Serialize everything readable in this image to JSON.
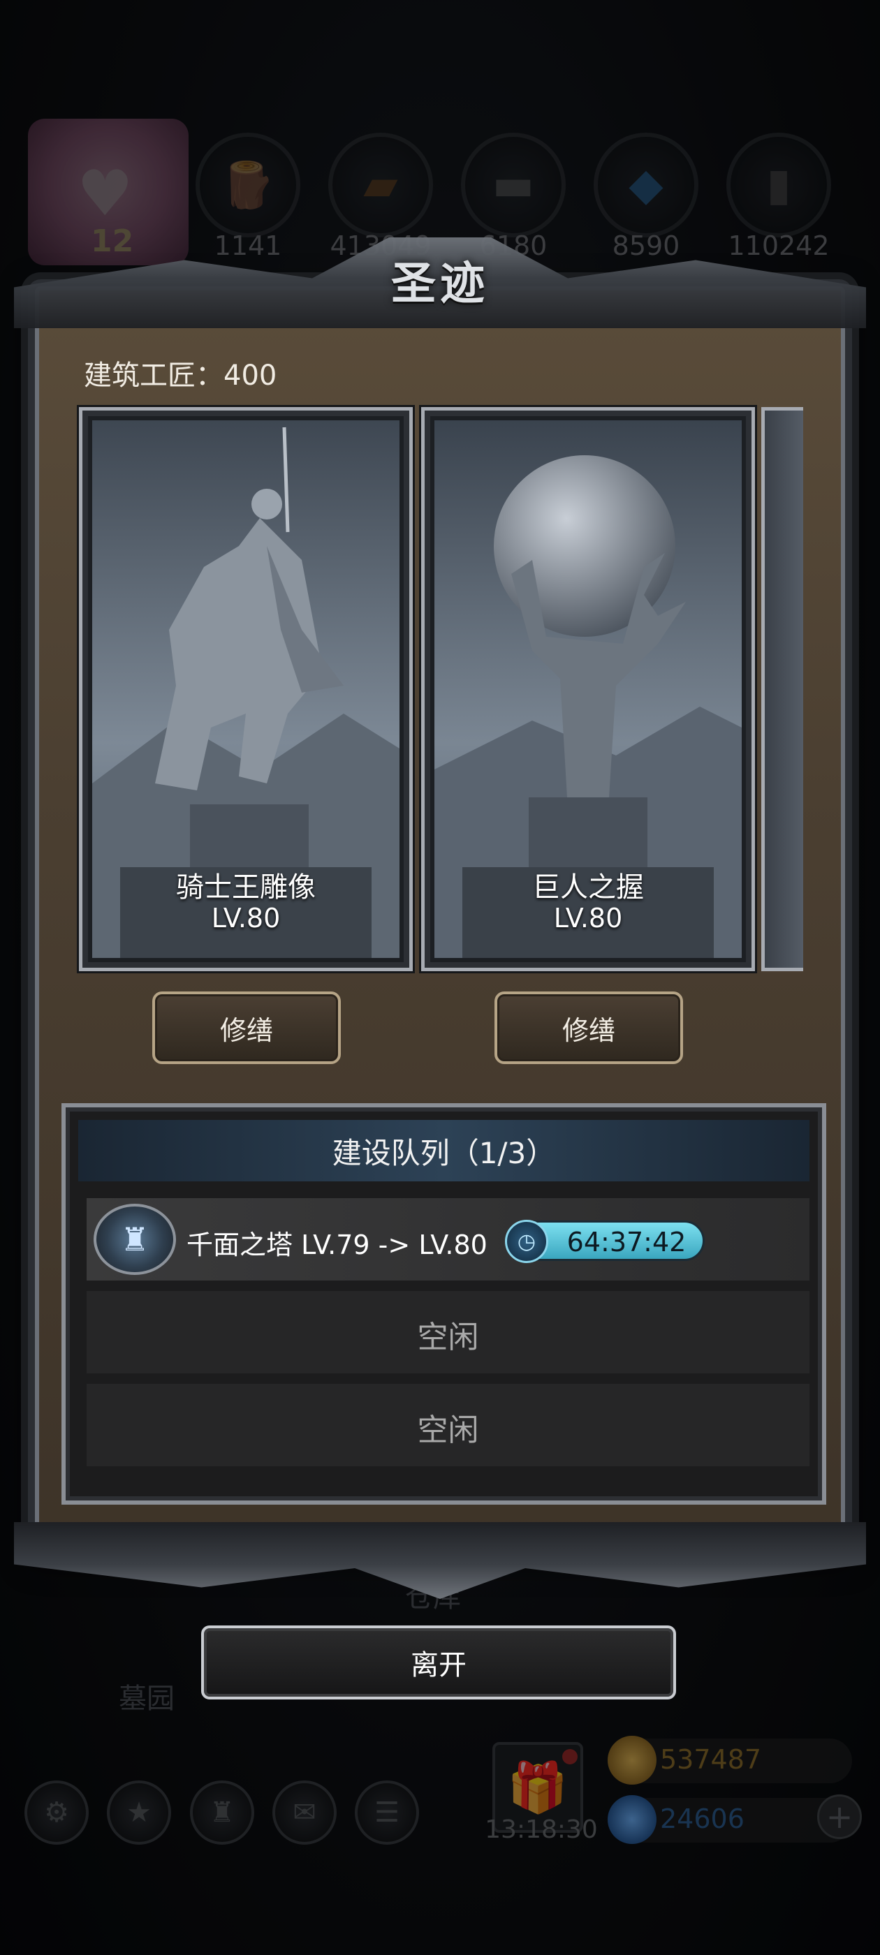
{
  "background": {
    "event_level": "12",
    "resources": [
      {
        "icon": "wood-icon",
        "value": "1141"
      },
      {
        "icon": "plank-icon",
        "value": "413049"
      },
      {
        "icon": "iron-icon",
        "value": "6180"
      },
      {
        "icon": "crystal-icon",
        "value": "8590"
      },
      {
        "icon": "stone-icon",
        "value": "110242"
      }
    ],
    "scene_labels": {
      "warehouse": "仓库",
      "cemetery": "墓园"
    },
    "gift_timer": "13:18:30",
    "gold": "537487",
    "gems": "24606"
  },
  "dialog": {
    "title": "圣迹",
    "builders_label": "建筑工匠：400",
    "cards": [
      {
        "name": "骑士王雕像",
        "level": "LV.80",
        "repair_label": "修缮"
      },
      {
        "name": "巨人之握",
        "level": "LV.80",
        "repair_label": "修缮"
      }
    ],
    "queue": {
      "title": "建设队列（1/3）",
      "active": {
        "text": "千面之塔 LV.79 -> LV.80",
        "timer": "64:37:42"
      },
      "idle_label_1": "空闲",
      "idle_label_2": "空闲"
    },
    "leave_label": "离开"
  },
  "colors": {
    "dialog_bg": "#4b3f31",
    "queue_bg": "#1c1c1d",
    "timer": "#5cc6dc",
    "gold_text": "#c29a3b",
    "gem_text": "#3f79b8"
  }
}
